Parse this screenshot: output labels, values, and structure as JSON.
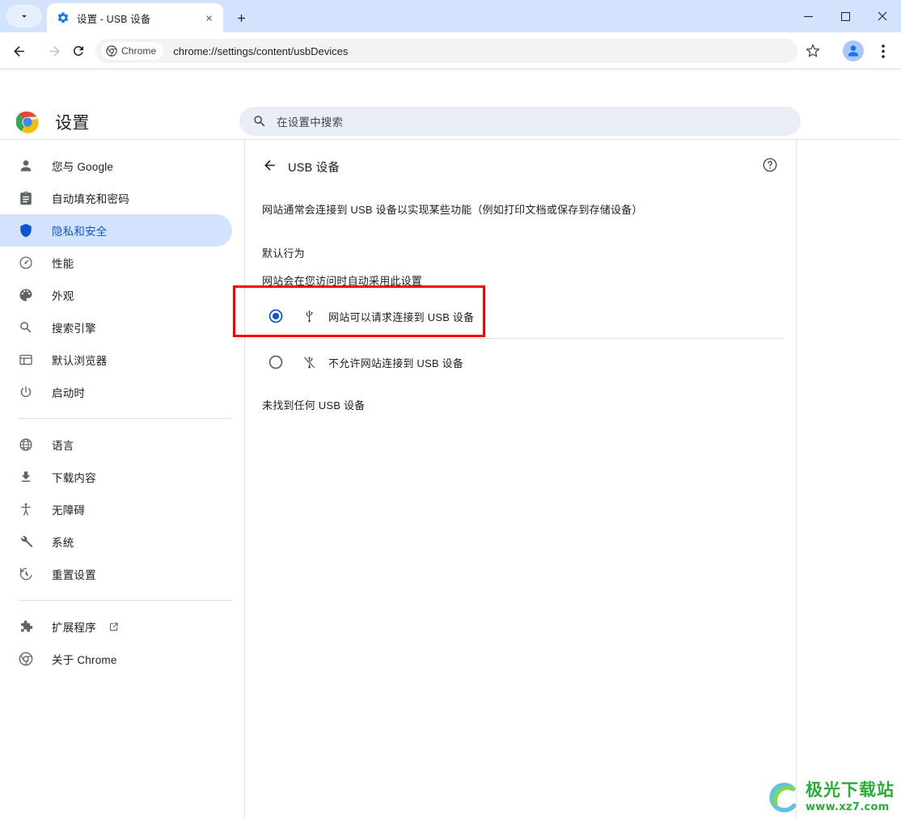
{
  "window": {
    "minimize_label": "minimize",
    "maximize_label": "maximize",
    "close_label": "close"
  },
  "tabstrip": {
    "tab_search_tooltip": "搜索标签页",
    "new_tab_tooltip": "新建标签页",
    "tabs": [
      {
        "title": "设置 - USB 设备",
        "favicon": "gear-icon",
        "close_label": "×"
      }
    ]
  },
  "toolbar": {
    "back_tooltip": "返回",
    "forward_tooltip": "前进",
    "reload_tooltip": "重新加载",
    "chip_label": "Chrome",
    "url": "chrome://settings/content/usbDevices",
    "bookmark_tooltip": "收藏",
    "profile_tooltip": "个人资料",
    "menu_tooltip": "自定义及控制 Google Chrome"
  },
  "settings_header": {
    "title": "设置",
    "search_placeholder": "在设置中搜索"
  },
  "sidebar": {
    "groups": [
      {
        "items": [
          {
            "label": "您与 Google",
            "icon": "person-icon",
            "active": false
          },
          {
            "label": "自动填充和密码",
            "icon": "clipboard-icon",
            "active": false
          },
          {
            "label": "隐私和安全",
            "icon": "shield-icon",
            "active": true
          },
          {
            "label": "性能",
            "icon": "speedometer-icon",
            "active": false
          },
          {
            "label": "外观",
            "icon": "palette-icon",
            "active": false
          },
          {
            "label": "搜索引擎",
            "icon": "search-icon",
            "active": false
          },
          {
            "label": "默认浏览器",
            "icon": "browser-window-icon",
            "active": false
          },
          {
            "label": "启动时",
            "icon": "power-icon",
            "active": false
          }
        ]
      },
      {
        "items": [
          {
            "label": "语言",
            "icon": "globe-icon",
            "active": false
          },
          {
            "label": "下载内容",
            "icon": "download-icon",
            "active": false
          },
          {
            "label": "无障碍",
            "icon": "accessibility-icon",
            "active": false
          },
          {
            "label": "系统",
            "icon": "wrench-icon",
            "active": false
          },
          {
            "label": "重置设置",
            "icon": "history-restore-icon",
            "active": false
          }
        ]
      },
      {
        "items": [
          {
            "label": "扩展程序",
            "icon": "puzzle-icon",
            "active": false,
            "external": true
          },
          {
            "label": "关于 Chrome",
            "icon": "chrome-icon",
            "active": false
          }
        ]
      }
    ]
  },
  "content": {
    "back_label": "返回",
    "title": "USB 设备",
    "help_label": "帮助",
    "description": "网站通常会连接到 USB 设备以实现某些功能（例如打印文档或保存到存储设备）",
    "default_behavior_label": "默认行为",
    "default_behavior_sub": "网站会在您访问时自动采用此设置",
    "options": [
      {
        "label": "网站可以请求连接到 USB 设备",
        "icon": "usb-icon",
        "selected": true
      },
      {
        "label": "不允许网站连接到 USB 设备",
        "icon": "usb-off-icon",
        "selected": false
      }
    ],
    "empty_state": "未找到任何 USB 设备"
  },
  "annotation": {
    "color": "#ff0000",
    "target": "网站可以请求连接到 USB 设备"
  },
  "watermark": {
    "main": "极光下载站",
    "sub": "www.xz7.com",
    "color": "#27ae35"
  },
  "colors": {
    "tabstrip_bg": "#d3e3fd",
    "active_nav_bg": "#d3e3fd",
    "accent_blue": "#0b57d0",
    "omnibox_bg": "#f1f3f4",
    "search_bg": "#e9eef6"
  }
}
